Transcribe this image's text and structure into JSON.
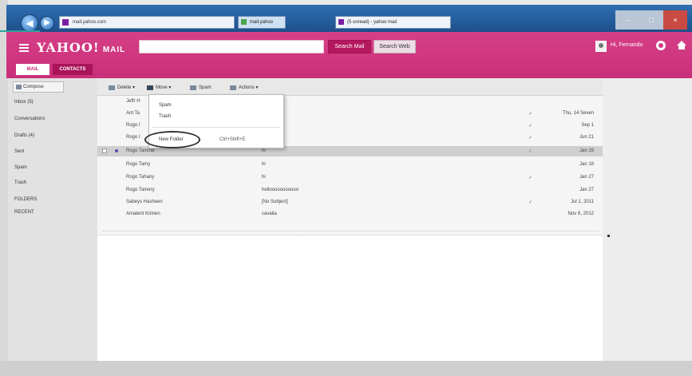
{
  "browser": {
    "address": "mail.yahoo.com",
    "tabs": [
      {
        "label": "mail.yahoo"
      },
      {
        "label": "(5 unread) - yahoo mail"
      }
    ],
    "controls": {
      "minimize": "–",
      "maximize": "□",
      "close": "×"
    }
  },
  "header": {
    "logo": "YAHOO!",
    "logo_suffix": "MAIL",
    "search_placeholder": "",
    "search_mail_label": "Search Mail",
    "search_web_label": "Search Web",
    "username": "Hi, Fernando",
    "tabs": [
      {
        "label": "MAIL"
      },
      {
        "label": "CONTACTS"
      }
    ]
  },
  "sidebar": {
    "compose_label": "Compose",
    "folders": [
      {
        "label": "Inbox (5)"
      },
      {
        "label": "Conversations"
      },
      {
        "label": "Drafts (4)"
      },
      {
        "label": "Sent"
      },
      {
        "label": "Spam"
      },
      {
        "label": "Trash"
      },
      {
        "label": "FOLDERS"
      },
      {
        "label": "RECENT"
      }
    ]
  },
  "toolbar": {
    "delete_label": "Delete",
    "move_label": "Move",
    "spam_label": "Spam",
    "actions_label": "Actions"
  },
  "move_menu": {
    "items": [
      {
        "label": "Spam"
      },
      {
        "label": "Trash"
      },
      {
        "label": "New Folder"
      }
    ],
    "new_folder_shortcut": "Ctrl+Shift+E"
  },
  "emails": [
    {
      "sender": "Jeffr H",
      "subject": "",
      "attachment": "",
      "date": ""
    },
    {
      "sender": "Ant Ta",
      "subject": "",
      "attachment": "✓",
      "date": "Thu, 14 Seven"
    },
    {
      "sender": "Rogo I",
      "subject": "",
      "attachment": "✓",
      "date": "Sep 1"
    },
    {
      "sender": "Rogo I",
      "subject": "",
      "attachment": "✓",
      "date": "Jun 21"
    },
    {
      "sender": "Rogo Tamina",
      "subject": "hi",
      "attachment": "✓",
      "date": "Jan 19"
    },
    {
      "sender": "Rogo Tamy",
      "subject": "hi",
      "attachment": "",
      "date": "Jan 18"
    },
    {
      "sender": "Rogo Tahany",
      "subject": "hi",
      "attachment": "✓",
      "date": "Jan 27"
    },
    {
      "sender": "Rogo Tamery",
      "subject": "hellooooooooooo",
      "attachment": "",
      "date": "Jan 27"
    },
    {
      "sender": "Sabeys Hasheen",
      "subject": "[No Subject]",
      "attachment": "✓",
      "date": "Jul 1, 2011"
    },
    {
      "sender": "Amatent Kriinen",
      "subject": "cavalia",
      "attachment": "",
      "date": "Nov 8, 2012"
    }
  ],
  "colors": {
    "brand": "#c92f79",
    "brand_dark": "#a9145a",
    "browser_bar": "#2f6fb2"
  }
}
